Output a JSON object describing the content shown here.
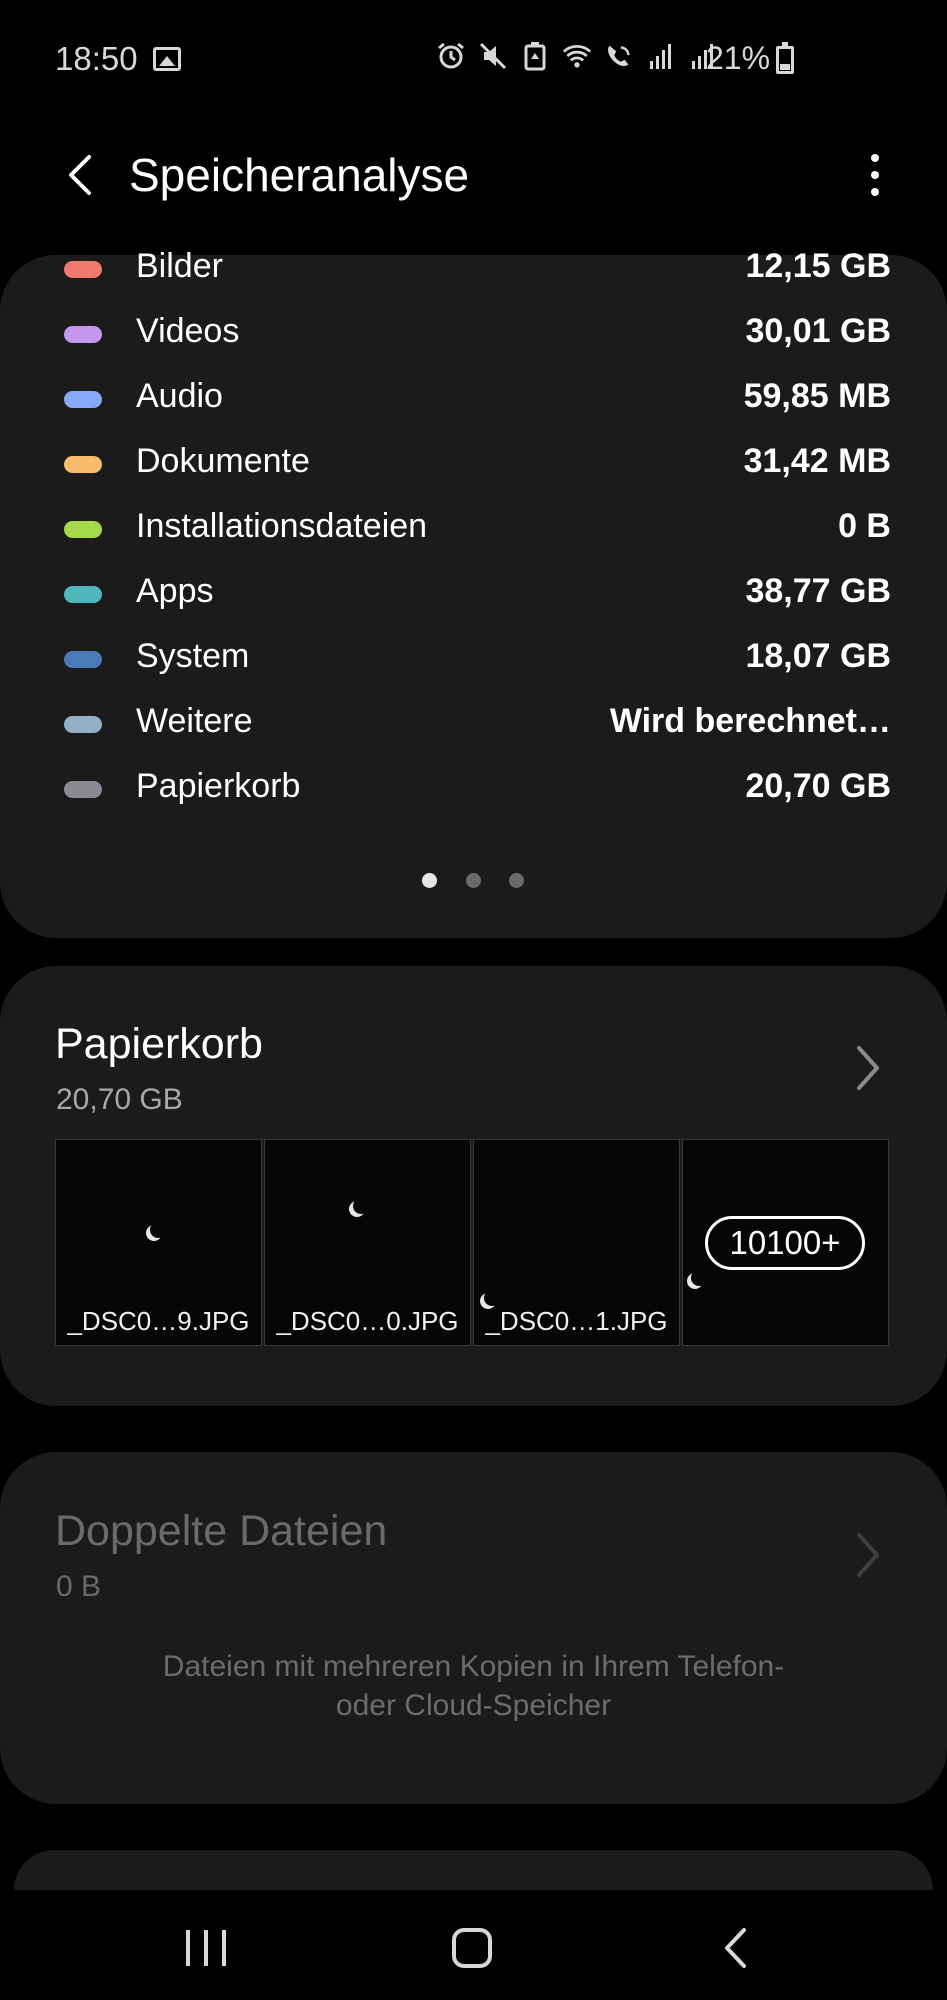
{
  "status_bar": {
    "time": "18:50",
    "battery_percent": "21%",
    "icons": [
      "image-icon",
      "alarm-icon",
      "mute-icon",
      "recycle-icon",
      "wifi-icon",
      "wifi-call-icon",
      "signal-icon",
      "signal-roaming-icon",
      "battery-icon"
    ]
  },
  "app_bar": {
    "title": "Speicheranalyse",
    "back_icon": "chevron-left-icon",
    "more_icon": "more-vertical-icon"
  },
  "storage_legend": {
    "items": [
      {
        "label": "Bilder",
        "value": "12,15 GB",
        "color": "#f07a6e"
      },
      {
        "label": "Videos",
        "value": "30,01 GB",
        "color": "#c596f0"
      },
      {
        "label": "Audio",
        "value": "59,85 MB",
        "color": "#86a8f5"
      },
      {
        "label": "Dokumente",
        "value": "31,42 MB",
        "color": "#f6bb6c"
      },
      {
        "label": "Installationsdateien",
        "value": "0 B",
        "color": "#a3d94a"
      },
      {
        "label": "Apps",
        "value": "38,77 GB",
        "color": "#4fb8bd"
      },
      {
        "label": "System",
        "value": "18,07 GB",
        "color": "#4a7ab8"
      },
      {
        "label": "Weitere",
        "value": "Wird berechnet…",
        "color": "#94afc8"
      },
      {
        "label": "Papierkorb",
        "value": "20,70 GB",
        "color": "#8a8a93"
      }
    ],
    "pager": {
      "pages": 3,
      "active": 0
    }
  },
  "trash_card": {
    "title": "Papierkorb",
    "size": "20,70 GB",
    "thumbnails": [
      {
        "name": "_DSC0…9.JPG"
      },
      {
        "name": "_DSC0…0.JPG"
      },
      {
        "name": "_DSC0…1.JPG"
      }
    ],
    "more_count": "10100+"
  },
  "duplicates_card": {
    "title": "Doppelte Dateien",
    "size": "0 B",
    "description_line1": "Dateien mit mehreren Kopien in Ihrem Telefon-",
    "description_line2": "oder Cloud-Speicher"
  },
  "nav_bar": {
    "icons": [
      "recent-apps-icon",
      "home-icon",
      "back-icon"
    ]
  }
}
